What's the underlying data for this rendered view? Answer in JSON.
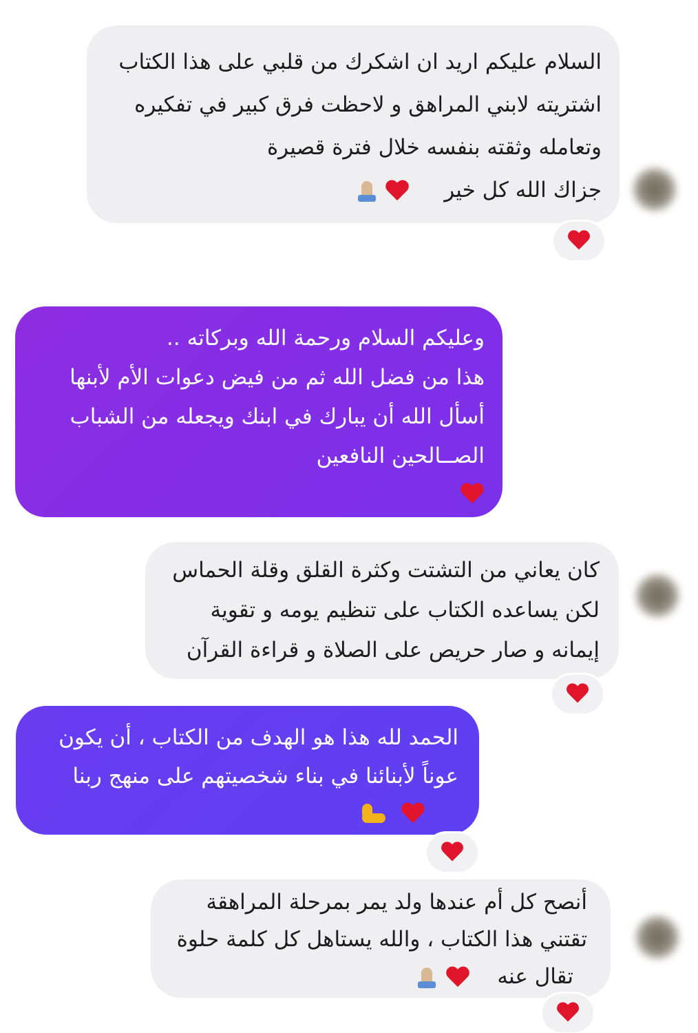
{
  "colors": {
    "incoming_bubble": "#efeff1",
    "outgoing_bubble_1": "#8a2be2",
    "outgoing_bubble_2": "#6a3cf0",
    "reaction_heart": "#e0152b"
  },
  "messages": [
    {
      "direction": "incoming",
      "lines": [
        "السلام عليكم اريد ان اشكرك من قلبي على هذا الكتاب",
        "اشتريته لابني المراهق و لاحظت فرق كبير في تفكيره",
        "وتعامله وثقته بنفسه خلال فترة قصيرة",
        "جزاك الله كل خير"
      ],
      "emojis": [
        "heart-icon",
        "folded-hands-icon"
      ],
      "reaction": "heart-icon"
    },
    {
      "direction": "outgoing",
      "lines": [
        "وعليكم السلام ورحمة الله وبركاته ..",
        "هذا من فضل الله ثم من فيض دعوات الأم لأبنها",
        "أسأل الله أن يبارك في ابنك ويجعله من الشباب",
        "الصــالحين النافعين"
      ],
      "emojis": [
        "heart-icon"
      ]
    },
    {
      "direction": "incoming",
      "lines": [
        "كان يعاني من التشتت وكثرة القلق وقلة الحماس",
        "لكن يساعده الكتاب على تنظيم يومه و تقوية",
        "إيمانه و صار حريص على الصلاة و قراءة القرآن"
      ],
      "reaction": "heart-icon"
    },
    {
      "direction": "outgoing",
      "lines": [
        "الحمد لله هذا هو الهدف من الكتاب ، أن يكون",
        "عوناً لأبنائنا في بناء شخصيتهم على منهج ربنا"
      ],
      "emojis": [
        "heart-icon",
        "flexed-biceps-icon"
      ],
      "reaction": "heart-icon"
    },
    {
      "direction": "incoming",
      "lines": [
        "أنصح كل أم عندها ولد يمر بمرحلة المراهقة",
        "تقتني هذا الكتاب ، والله يستاهل كل كلمة حلوة",
        "تقال عنه"
      ],
      "emojis": [
        "heart-icon",
        "folded-hands-icon"
      ],
      "reaction": "heart-icon"
    }
  ]
}
